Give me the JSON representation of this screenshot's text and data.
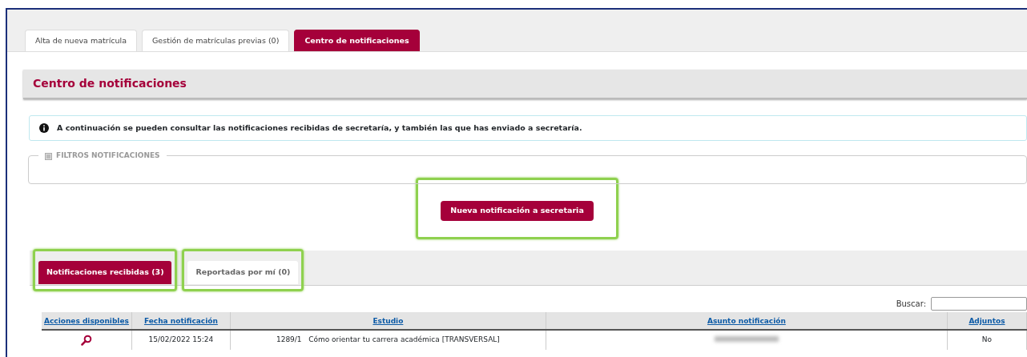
{
  "top_tabs": [
    {
      "label": "Alta de nueva matrícula",
      "selected": false
    },
    {
      "label": "Gestión de matrículas previas (0)",
      "selected": false
    },
    {
      "label": "Centro de notificaciones",
      "selected": true
    }
  ],
  "section_title": "Centro de notificaciones",
  "info_message": "A continuación se pueden consultar las notificaciones recibidas de secretaría, y también las que has enviado a secretaría.",
  "filters": {
    "legend": "FILTROS NOTIFICACIONES",
    "expanded": false
  },
  "new_button": {
    "label": "Nueva notificación a secretaria",
    "highlighted": true
  },
  "inner_tabs": [
    {
      "label": "Notificaciones recibidas (3)",
      "selected": true,
      "highlighted": true
    },
    {
      "label": "Reportadas por mí (0)",
      "selected": false,
      "highlighted": true
    }
  ],
  "search": {
    "label": "Buscar:"
  },
  "table": {
    "columns": [
      "Acciones disponibles",
      "Fecha notificación",
      "Estudio",
      "Asunto notificación",
      "Adjuntos"
    ],
    "rows": [
      {
        "viewable": true,
        "date": "15/02/2022 15:24",
        "study": "1289/1   Cómo orientar tu carrera académica [TRANSVERSAL]",
        "subject_redacted": true,
        "attachments": "No"
      }
    ]
  }
}
